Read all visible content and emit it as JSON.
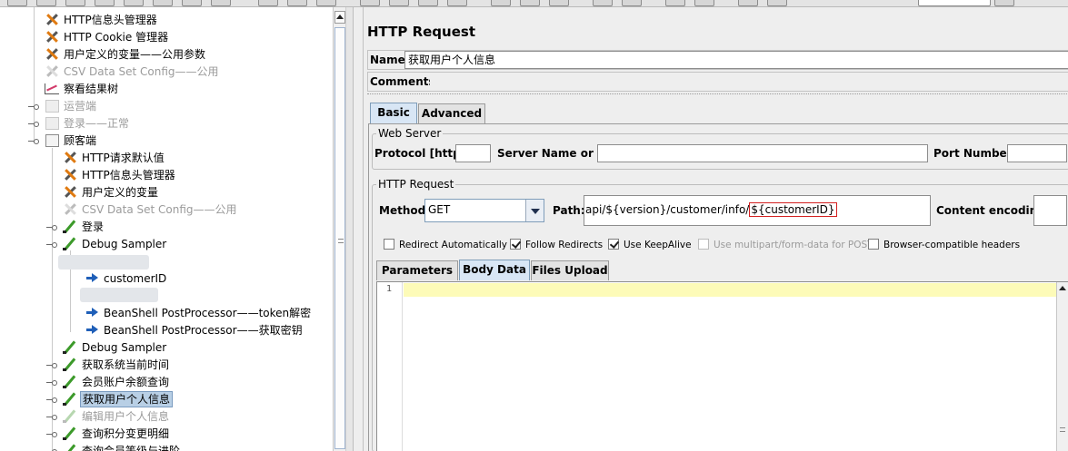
{
  "tree": {
    "items": [
      {
        "label": "HTTP信息头管理器",
        "icon": "wrench-icon"
      },
      {
        "label": "HTTP Cookie 管理器",
        "icon": "wrench-icon"
      },
      {
        "label": "用户定义的变量——公用参数",
        "icon": "wrench-icon"
      },
      {
        "label": "CSV Data Set Config——公用",
        "icon": "wrench-icon"
      },
      {
        "label": "察看结果树",
        "icon": "chart-icon"
      },
      {
        "label": "运营端",
        "icon": "group-icon"
      },
      {
        "label": "登录——正常",
        "icon": "group-icon"
      },
      {
        "label": "顾客端",
        "icon": "group-icon"
      },
      {
        "label": "HTTP请求默认值",
        "icon": "wrench-icon"
      },
      {
        "label": "HTTP信息头管理器",
        "icon": "wrench-icon"
      },
      {
        "label": "用户定义的变量",
        "icon": "wrench-icon"
      },
      {
        "label": "CSV Data Set Config——公用",
        "icon": "wrench-icon"
      },
      {
        "label": "登录",
        "icon": "pencil-icon"
      },
      {
        "label": "Debug Sampler",
        "icon": "pencil-icon"
      },
      {
        "label": "customerID",
        "icon": "arrow-icon"
      },
      {
        "label": "BeanShell PostProcessor——token解密",
        "icon": "arrow-icon"
      },
      {
        "label": "BeanShell PostProcessor——获取密钥",
        "icon": "arrow-icon"
      },
      {
        "label": "Debug Sampler",
        "icon": "pencil-icon"
      },
      {
        "label": "获取系统当前时间",
        "icon": "pencil-icon"
      },
      {
        "label": "会员账户余额查询",
        "icon": "pencil-icon"
      },
      {
        "label": "获取用户个人信息",
        "icon": "pencil-icon"
      },
      {
        "label": "编辑用户个人信息",
        "icon": "pencil-icon"
      },
      {
        "label": "查询积分变更明细",
        "icon": "pencil-icon"
      },
      {
        "label": "查询会员等级与进阶",
        "icon": "pencil-icon"
      }
    ]
  },
  "panel": {
    "title": "HTTP Request",
    "name_label": "Name:",
    "name_value": "获取用户个人信息",
    "comments_label": "Comments:",
    "tabs": [
      "Basic",
      "Advanced"
    ],
    "web_server": {
      "legend": "Web Server",
      "protocol_label": "Protocol [http]:",
      "protocol_value": "",
      "server_label": "Server Name or IP:",
      "server_value": "",
      "port_label": "Port Number:",
      "port_value": ""
    },
    "http_request": {
      "legend": "HTTP Request",
      "method_label": "Method:",
      "method_value": "GET",
      "path_label": "Path:",
      "path_prefix": "api/${version}/customer/info/",
      "path_var": "${customerID}",
      "encoding_label": "Content encoding:",
      "encoding_value": ""
    },
    "options": [
      {
        "label": "Redirect Automatically",
        "checked": false
      },
      {
        "label": "Follow Redirects",
        "checked": true
      },
      {
        "label": "Use KeepAlive",
        "checked": true
      },
      {
        "label": "Use multipart/form-data for POST",
        "checked": false
      },
      {
        "label": "Browser-compatible headers",
        "checked": false
      }
    ],
    "sub_tabs": [
      "Parameters",
      "Body Data",
      "Files Upload"
    ],
    "editor": {
      "line_number": "1",
      "content": ""
    }
  },
  "colors": {
    "selection": "#b8cfe5",
    "highlight_border": "#d42020",
    "current_line": "#fdfbb8"
  }
}
